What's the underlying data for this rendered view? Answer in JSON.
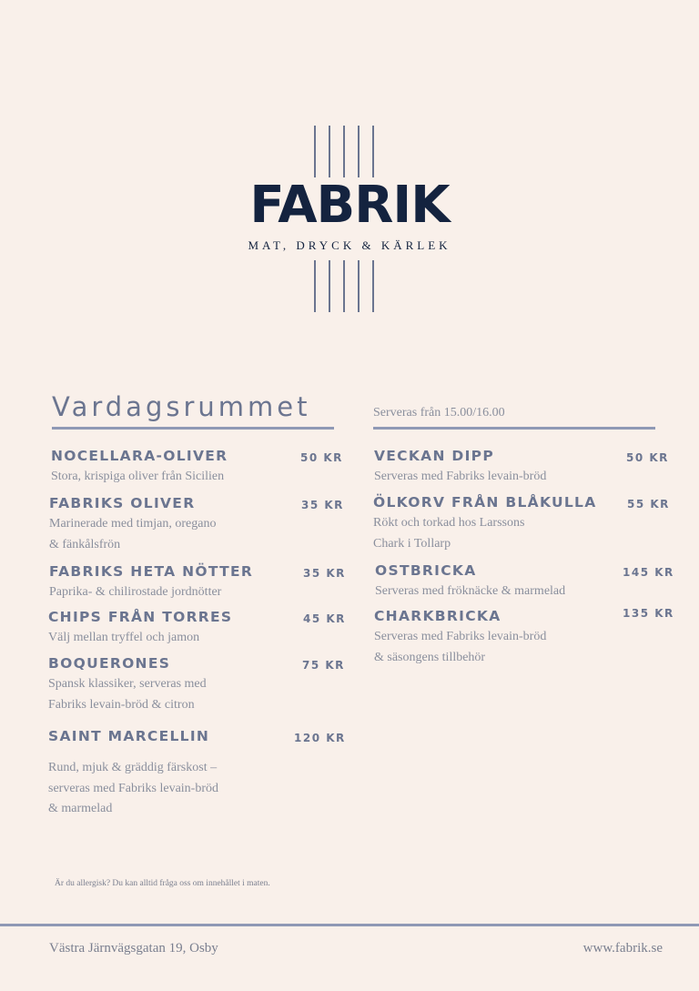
{
  "brand": {
    "name": "FABRIK",
    "tagline": "MAT, DRYCK & KÄRLEK"
  },
  "section": {
    "title": "Vardagsrummet",
    "subtitle": "Serveras från 15.00/16.00"
  },
  "left_items": [
    {
      "name": "NOCELLARA-OLIVER",
      "price": "50 KR",
      "desc": [
        "Stora, krispiga oliver från Sicilien"
      ]
    },
    {
      "name": "FABRIKS OLIVER",
      "price": "35 KR",
      "desc": [
        "Marinerade med timjan, oregano",
        "& fänkålsfrön"
      ]
    },
    {
      "name": "FABRIKS HETA NÖTTER",
      "price": "35 KR",
      "desc": [
        "Paprika- & chilirostade jordnötter"
      ]
    },
    {
      "name": "CHIPS FRÅN TORRES",
      "price": "45 KR",
      "desc": [
        "Välj mellan tryffel och jamon"
      ]
    },
    {
      "name": "BOQUERONES",
      "price": "75 KR",
      "desc": [
        "Spansk klassiker, serveras med",
        "Fabriks levain-bröd & citron"
      ]
    },
    {
      "name": "SAINT MARCELLIN",
      "price": "120 KR",
      "desc": [
        "Rund, mjuk & gräddig färskost –",
        "serveras med Fabriks levain-bröd",
        "& marmelad"
      ]
    }
  ],
  "right_items": [
    {
      "name": "VECKAN DIPP",
      "price": "50 KR",
      "desc": [
        "Serveras med Fabriks levain-bröd"
      ]
    },
    {
      "name": "ÖLKORV  FRÅN BLÅKULLA",
      "price": "55 KR",
      "desc": [
        "Rökt och torkad hos Larssons",
        "Chark i Tollarp"
      ]
    },
    {
      "name": "OSTBRICKA",
      "price": "145 KR",
      "desc": [
        "Serveras med fröknäcke & marmelad"
      ]
    },
    {
      "name": "CHARKBRICKA",
      "price": "135 KR",
      "desc": [
        "Serveras med Fabriks levain-bröd",
        "& säsongens tillbehör"
      ]
    }
  ],
  "allergy_note": "Är du allergisk? Du kan alltid fråga oss om innehållet i maten.",
  "footer": {
    "address": "Västra Järnvägsgatan 19, Osby",
    "website": "www.fabrik.se"
  }
}
